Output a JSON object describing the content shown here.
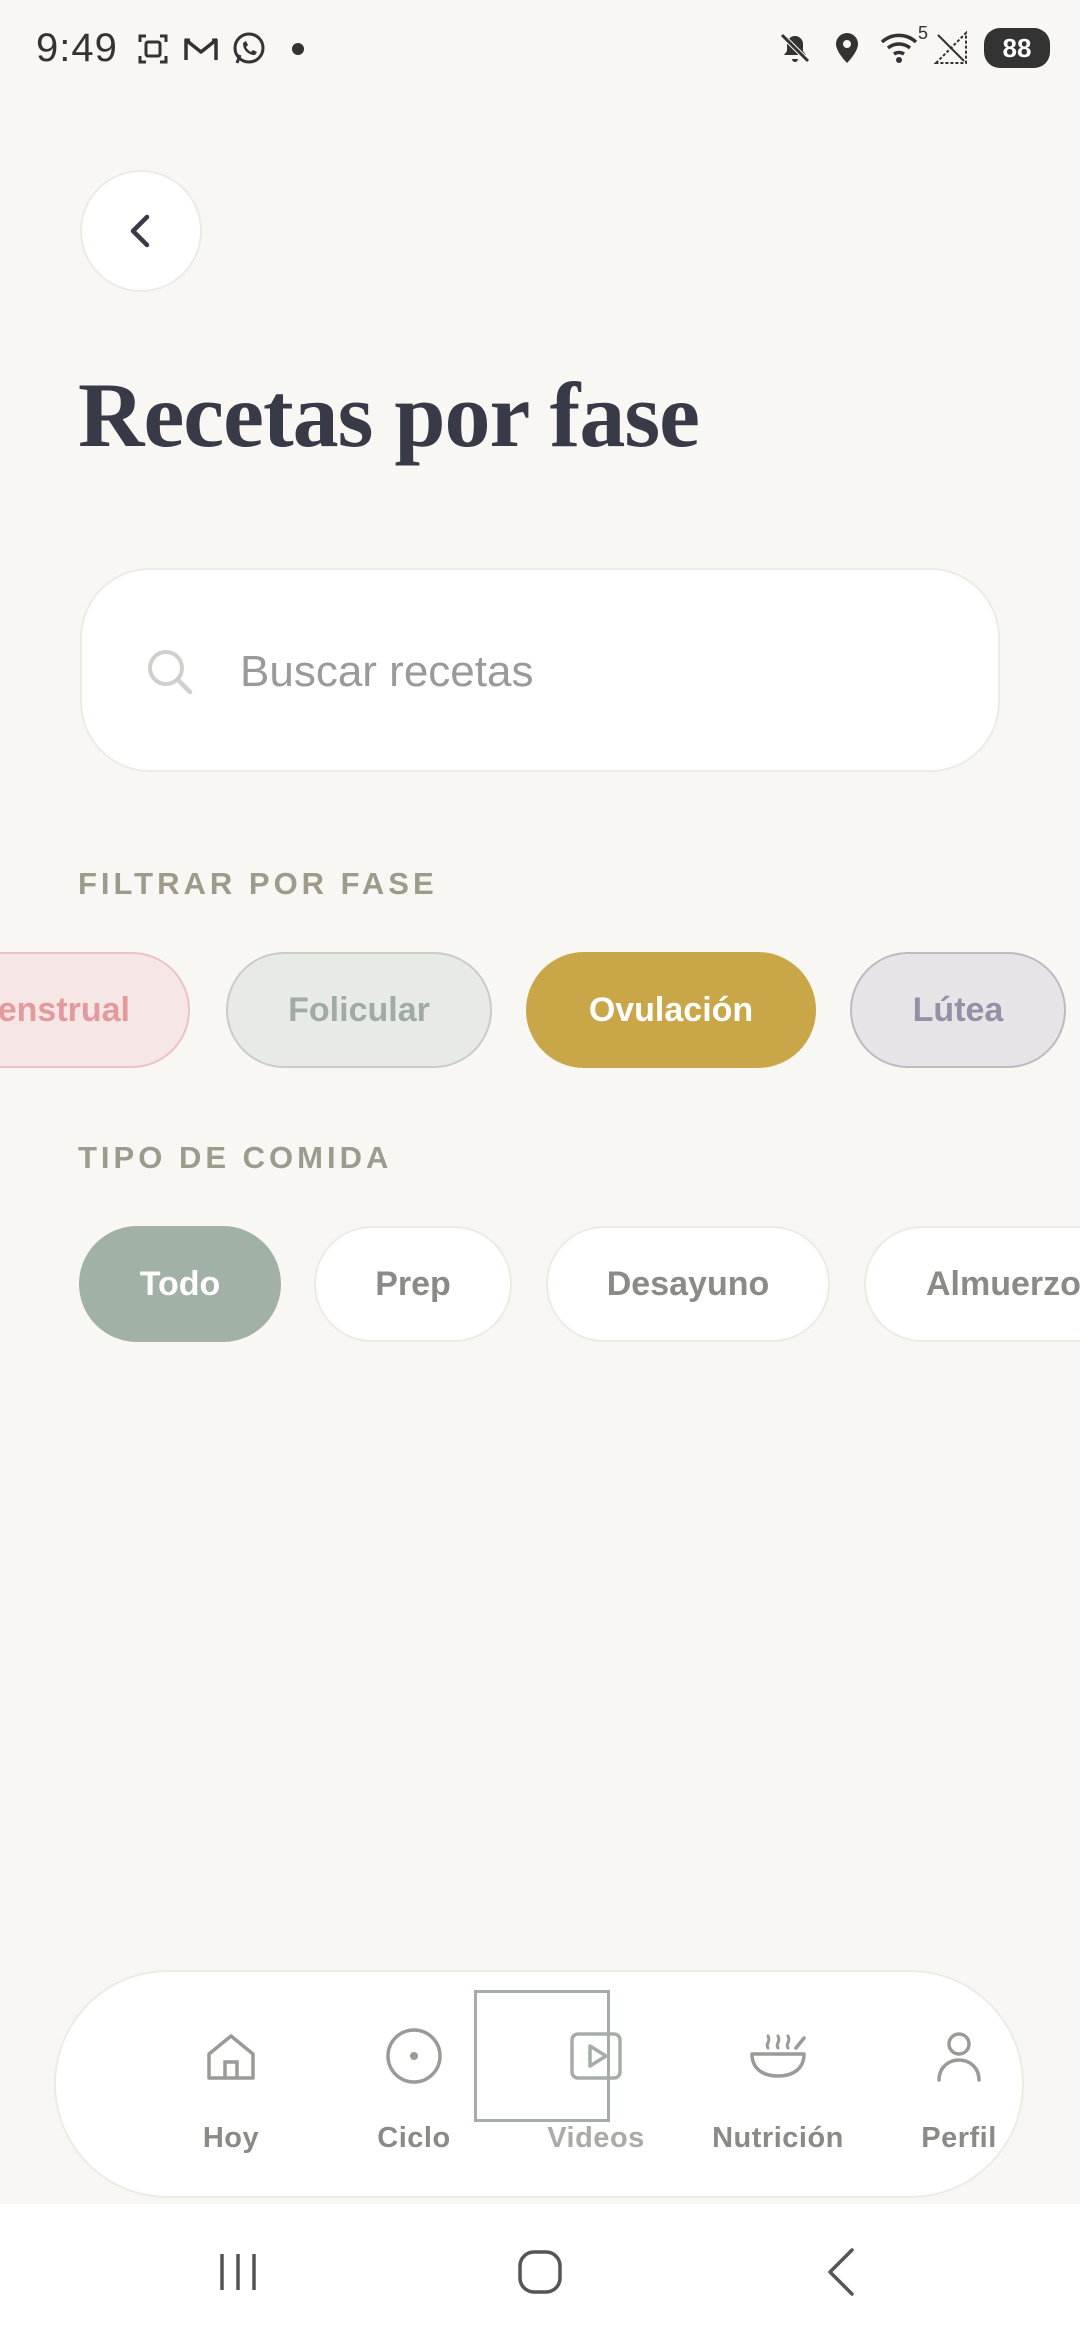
{
  "status_bar": {
    "time": "9:49",
    "left_icons": [
      "screenshot-icon",
      "gmail-icon",
      "whatsapp-icon",
      "notification-dot"
    ],
    "right_icons": [
      "mute-icon",
      "location-icon",
      "wifi-icon",
      "signal-icon"
    ],
    "wifi_label": "5",
    "battery": "88"
  },
  "header": {
    "back_icon": "chevron-left-icon",
    "title": "Recetas por fase"
  },
  "search": {
    "icon": "search-icon",
    "placeholder": "Buscar recetas",
    "value": ""
  },
  "phase_filter": {
    "label": "FILTRAR POR FASE",
    "options": [
      {
        "label": "Menstrual",
        "visible_text": "enstrual",
        "color": "#e29a9c",
        "selected": false
      },
      {
        "label": "Folicular",
        "color": "#9eaca4",
        "selected": false
      },
      {
        "label": "Ovulación",
        "color": "#c9a648",
        "selected": true
      },
      {
        "label": "Lútea",
        "color": "#978fa5",
        "selected": false
      }
    ]
  },
  "meal_filter": {
    "label": "TIPO DE COMIDA",
    "options": [
      {
        "label": "Todo",
        "selected": true
      },
      {
        "label": "Prep",
        "selected": false
      },
      {
        "label": "Desayuno",
        "selected": false
      },
      {
        "label": "Almuerzo",
        "selected": false
      }
    ]
  },
  "bottom_nav": {
    "items": [
      {
        "label": "Hoy",
        "icon": "home-icon"
      },
      {
        "label": "Ciclo",
        "icon": "cycle-icon"
      },
      {
        "label": "Videos",
        "icon": "video-play-icon",
        "focused": true
      },
      {
        "label": "Nutrición",
        "icon": "bowl-icon"
      },
      {
        "label": "Perfil",
        "icon": "user-icon"
      }
    ]
  },
  "system_nav": [
    "recents-icon",
    "home-circle-icon",
    "back-icon"
  ],
  "colors": {
    "background": "#f8f7f3",
    "title": "#383a48",
    "section_label": "#9e9b8c",
    "sage": "#a1b1a6"
  }
}
